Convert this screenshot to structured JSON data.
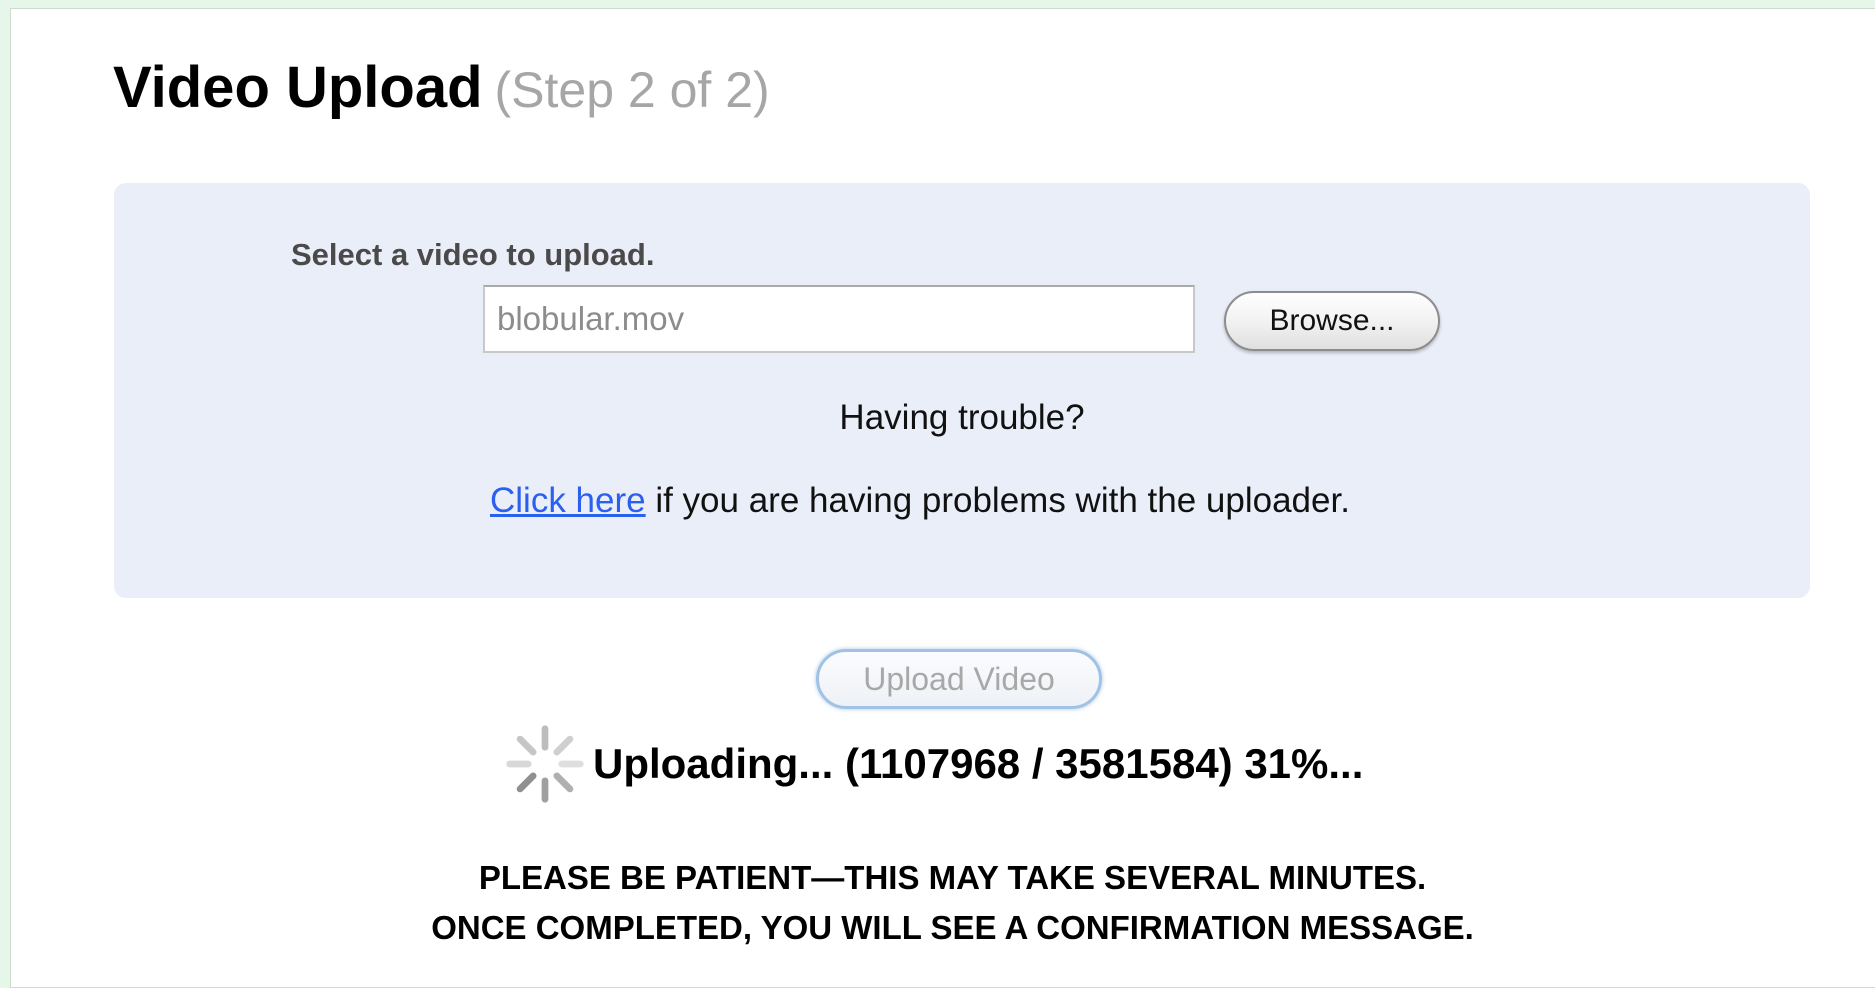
{
  "header": {
    "title": "Video Upload",
    "step": "(Step 2 of 2)"
  },
  "upload_panel": {
    "select_label": "Select a video to upload.",
    "file_value": "blobular.mov",
    "browse_label": "Browse...",
    "trouble_text": "Having trouble?",
    "help_link": "Click here",
    "help_suffix": " if you are having problems with the uploader."
  },
  "upload_button_label": "Upload Video",
  "progress": {
    "text": "Uploading... (1107968 / 3581584) 31%...",
    "bytes_uploaded": 1107968,
    "bytes_total": 3581584,
    "percent": 31,
    "icon": "spinner-icon"
  },
  "notice": {
    "line1": "PLEASE BE PATIENT—THIS MAY TAKE SEVERAL MINUTES.",
    "line2": "ONCE COMPLETED, YOU WILL SEE A CONFIRMATION MESSAGE."
  },
  "colors": {
    "panel_background": "#e9eef8",
    "link": "#2a5ff0",
    "page_background": "#e6f7ea"
  }
}
